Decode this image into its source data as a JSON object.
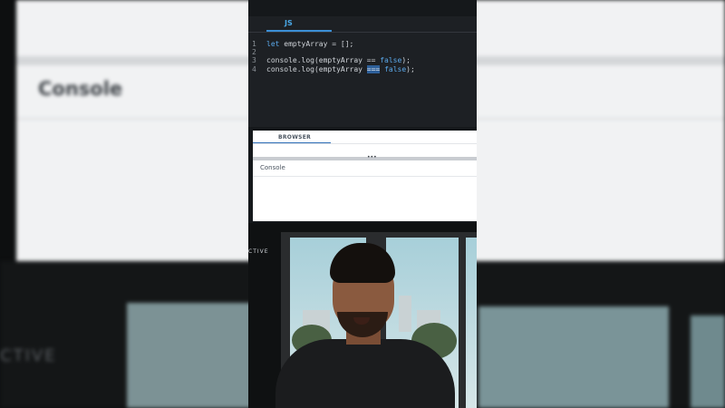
{
  "background": {
    "console_label": "Console",
    "active_fragment": "CTIVE"
  },
  "editor": {
    "tab_label": "JS",
    "line_numbers": [
      "1",
      "2",
      "3",
      "4"
    ],
    "lines": [
      {
        "kw": "let",
        "text": " emptyArray = [];"
      },
      {
        "kw": "",
        "text": ""
      },
      {
        "pre": "console.log(emptyArray == ",
        "kw": "false",
        "post": ");"
      },
      {
        "pre": "console.log(emptyArray ",
        "sel": "===",
        "mid": " ",
        "kw": "false",
        "post": ");"
      }
    ]
  },
  "browser": {
    "tab_label": "BROWSER",
    "splitter_grip": "•••",
    "console_label": "Console"
  },
  "video": {
    "active_fragment": "CTIVE"
  },
  "colors": {
    "accent_blue": "#4aa9e8",
    "keyword": "#5aa8ea",
    "editor_bg": "#1d2024"
  }
}
